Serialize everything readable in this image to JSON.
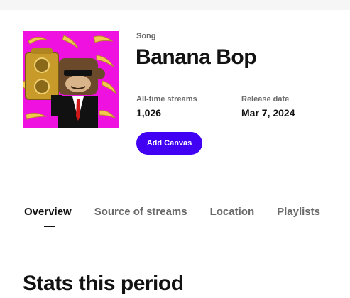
{
  "song": {
    "type_label": "Song",
    "title": "Banana Bop",
    "cover_background": "#ee11e0",
    "stats": [
      {
        "label": "All-time streams",
        "value": "1,026"
      },
      {
        "label": "Release date",
        "value": "Mar 7, 2024"
      }
    ],
    "add_canvas_label": "Add Canvas",
    "accent_color": "#4100f4"
  },
  "tabs": [
    {
      "label": "Overview",
      "active": true
    },
    {
      "label": "Source of streams",
      "active": false
    },
    {
      "label": "Location",
      "active": false
    },
    {
      "label": "Playlists",
      "active": false
    }
  ],
  "section": {
    "heading": "Stats this period"
  }
}
